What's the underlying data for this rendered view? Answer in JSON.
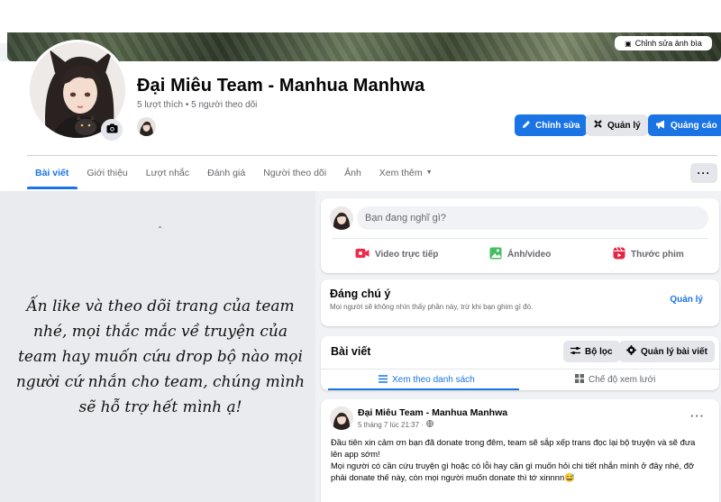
{
  "cover": {
    "edit_label": "Chỉnh sửa ảnh bìa"
  },
  "page": {
    "name": "Đại Miêu Team - Manhua Manhwa",
    "stats": "5 lượt thích • 5 người theo dõi"
  },
  "header_actions": {
    "edit_label": "Chỉnh sửa",
    "manage_label": "Quản lý",
    "advertise_label": "Quảng cáo"
  },
  "tabs": [
    {
      "label": "Bài viết"
    },
    {
      "label": "Giới thiệu"
    },
    {
      "label": "Lượt nhắc"
    },
    {
      "label": "Đánh giá"
    },
    {
      "label": "Người theo dõi"
    },
    {
      "label": "Ảnh"
    },
    {
      "label": "Xem thêm"
    }
  ],
  "promo": {
    "lines": [
      "Ấn like và theo dõi trang của team",
      "nhé, mọi thắc mắc về truyện của",
      "team hay muốn cứu drop bộ nào mọi",
      "người cứ nhắn cho team, chúng mình",
      "sẽ hỗ trợ hết mình ạ!"
    ]
  },
  "composer": {
    "placeholder": "Bạn đang nghĩ gì?",
    "live_label": "Video trực tiếp",
    "photo_label": "Ảnh/video",
    "reel_label": "Thước phim"
  },
  "pinned": {
    "title": "Đáng chú ý",
    "subtitle": "Mọi người sẽ không nhìn thấy phần này, trừ khi bạn ghim gì đó.",
    "manage_label": "Quản lý"
  },
  "posts_section": {
    "title": "Bài viết",
    "filter_label": "Bộ lọc",
    "manage_posts_label": "Quản lý bài viết",
    "list_view_label": "Xem theo danh sách",
    "grid_view_label": "Chế độ xem lưới"
  },
  "post": {
    "author": "Đại Miêu Team - Manhua Manhwa",
    "timestamp": "5 tháng 7 lúc 21:37 ·",
    "body_lines": [
      "Đầu tiên xin cảm ơn bạn đã donate trong đêm, team sẽ sắp xếp trans đọc lại bộ truyện và sẽ đưa",
      "lên app sớm!",
      "Mọi người có cần cứu truyện gì hoặc có lỗi hay cần gì muốn hỏi chi tiết nhắn mình ở đây nhé, đỡ",
      "phải donate thế này, còn mọi người muốn donate thì tớ xinnnn😅"
    ]
  },
  "colors": {
    "accent": "#1b74e4",
    "background": "#f0f2f5",
    "secondary_button": "#e4e6eb",
    "muted_text": "#65676b"
  },
  "icons": [
    "camera-icon",
    "pencil-icon",
    "gear-icon",
    "megaphone-icon",
    "live-video-icon",
    "photo-icon",
    "reel-icon",
    "filter-icon",
    "list-icon",
    "grid-icon",
    "globe-icon",
    "more-dots-icon",
    "chevron-down-icon"
  ]
}
